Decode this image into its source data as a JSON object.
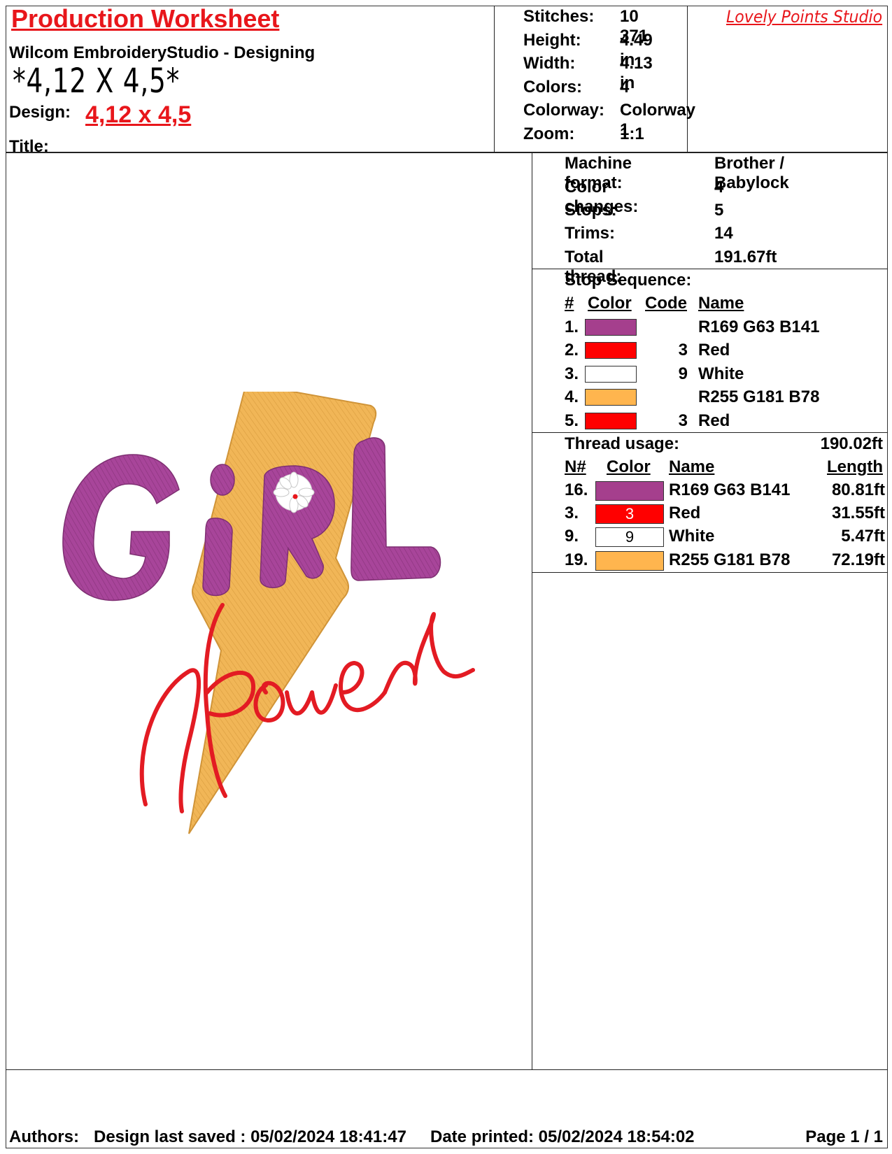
{
  "header": {
    "title": "Production Worksheet",
    "software": "Wilcom EmbroideryStudio - Designing",
    "size_handwritten": "*4,12 X 4,5*",
    "design_label": "Design:",
    "design_value": "4,12 x 4,5",
    "title_label": "Title:",
    "studio": "Lovely Points Studio"
  },
  "stats": [
    {
      "label": "Stitches:",
      "value": "10 371"
    },
    {
      "label": "Height:",
      "value": "4.49 in"
    },
    {
      "label": "Width:",
      "value": "4.13 in"
    },
    {
      "label": "Colors:",
      "value": "4"
    },
    {
      "label": "Colorway:",
      "value": "Colorway 1"
    },
    {
      "label": "Zoom:",
      "value": "1:1"
    }
  ],
  "machine": [
    {
      "label": "Machine format:",
      "value": "Brother / Babylock"
    },
    {
      "label": "Color changes:",
      "value": "4"
    },
    {
      "label": "Stops:",
      "value": "5"
    },
    {
      "label": "Trims:",
      "value": "14"
    },
    {
      "label": "Total thread:",
      "value": "191.67ft"
    }
  ],
  "stop_sequence": {
    "title": "Stop Sequence:",
    "headers": {
      "num": "#",
      "color": "Color",
      "code": "Code",
      "name": "Name"
    },
    "rows": [
      {
        "num": "1.",
        "color": "#a53f8d",
        "code": "",
        "name": "R169 G63 B141"
      },
      {
        "num": "2.",
        "color": "#ff0000",
        "code": "3",
        "name": "Red"
      },
      {
        "num": "3.",
        "color": "#ffffff",
        "code": "9",
        "name": "White"
      },
      {
        "num": "4.",
        "color": "#ffb54e",
        "code": "",
        "name": "R255 G181 B78"
      },
      {
        "num": "5.",
        "color": "#ff0000",
        "code": "3",
        "name": "Red"
      }
    ]
  },
  "thread_usage": {
    "title": "Thread usage:",
    "total": "190.02ft",
    "headers": {
      "num": "N#",
      "color": "Color",
      "name": "Name",
      "length": "Length"
    },
    "rows": [
      {
        "num": "16.",
        "color": "#a53f8d",
        "code": "",
        "name": "R169 G63 B141",
        "length": "80.81ft"
      },
      {
        "num": "3.",
        "color": "#ff0000",
        "code": "3",
        "name": "Red",
        "length": "31.55ft"
      },
      {
        "num": "9.",
        "color": "#ffffff",
        "code": "9",
        "name": "White",
        "length": "5.47ft"
      },
      {
        "num": "19.",
        "color": "#ffb54e",
        "code": "",
        "name": "R255 G181 B78",
        "length": "72.19ft"
      }
    ]
  },
  "footer": {
    "authors": "Authors:",
    "saved": "Design last saved : 05/02/2024 18:41:47",
    "printed": "Date printed: 05/02/2024 18:54:02",
    "page": "Page 1 / 1"
  },
  "colors": {
    "accent": "#e8161b",
    "purple": "#a53f8d",
    "gold": "#f0b44e",
    "red": "#e8161b"
  }
}
